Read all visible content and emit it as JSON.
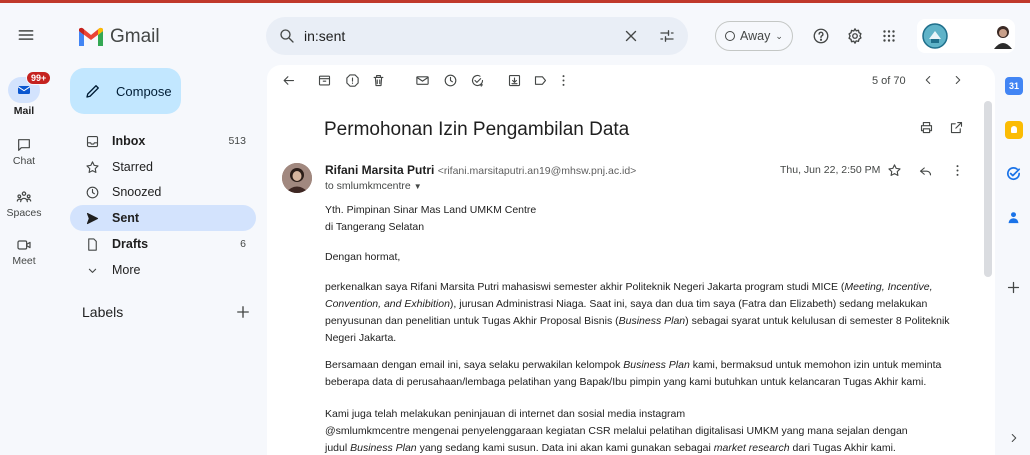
{
  "app": {
    "title": "Gmail"
  },
  "search": {
    "query": "in:sent"
  },
  "status": {
    "label": "Away"
  },
  "rail": {
    "mail": "Mail",
    "mail_badge": "99+",
    "chat": "Chat",
    "spaces": "Spaces",
    "meet": "Meet"
  },
  "nav": {
    "compose": "Compose",
    "items": [
      {
        "label": "Inbox",
        "count": "513"
      },
      {
        "label": "Starred",
        "count": ""
      },
      {
        "label": "Snoozed",
        "count": ""
      },
      {
        "label": "Sent",
        "count": ""
      },
      {
        "label": "Drafts",
        "count": "6"
      },
      {
        "label": "More",
        "count": ""
      }
    ],
    "labels_heading": "Labels"
  },
  "pager": {
    "text": "5 of 70"
  },
  "email": {
    "subject": "Permohonan Izin Pengambilan Data",
    "sender_name": "Rifani Marsita Putri",
    "sender_email": "<rifani.marsitaputri.an19@mhsw.pnj.ac.id>",
    "to": "to smlumkmcentre",
    "date": "Thu, Jun 22, 2:50 PM",
    "greeting1": "Yth. Pimpinan Sinar Mas Land UMKM Centre",
    "greeting2": "di Tangerang Selatan",
    "salutation": "Dengan hormat,",
    "p1_a": "perkenalkan saya Rifani Marsita Putri mahasiswi semester akhir Politeknik Negeri Jakarta program studi MICE (",
    "p1_b": "Meeting, Incentive, Convention, and Exhibition",
    "p1_c": "), jurusan Administrasi Niaga. Saat ini, saya dan dua tim saya (Fatra dan Elizabeth) sedang melakukan penyusunan dan penelitian untuk Tugas Akhir Proposal Bisnis (",
    "p1_d": "Business Plan",
    "p1_e": ") sebagai syarat untuk kelulusan di semester 8 Politeknik Negeri Jakarta.",
    "p2_a": "Bersamaan dengan email ini, saya selaku perwakilan kelompok ",
    "p2_b": "Business Plan",
    "p2_c": " kami, bermaksud untuk memohon izin untuk meminta beberapa data di perusahaan/lembaga pelatihan yang Bapak/Ibu pimpin yang kami butuhkan untuk kelancaran Tugas Akhir kami.",
    "p3_line1": "Kami juga telah melakukan peninjauan di internet dan sosial media instagram",
    "p3_line2": "@smlumkmcentre mengenai penyelenggaraan kegiatan CSR melalui pelatihan digitalisasi UMKM yang mana sejalan dengan",
    "p3_l3a": "judul ",
    "p3_l3b": "Business Plan",
    "p3_l3c": " yang sedang kami susun. Data ini akan kami gunakan sebagai ",
    "p3_l3d": "market research",
    "p3_l3e": " dari Tugas Akhir kami."
  },
  "colors": {
    "accent": "#0b57d0",
    "compose_bg": "#c2e7ff",
    "active_bg": "#d3e3fd",
    "badge": "#c5221f",
    "top_border": "#c0392b"
  }
}
